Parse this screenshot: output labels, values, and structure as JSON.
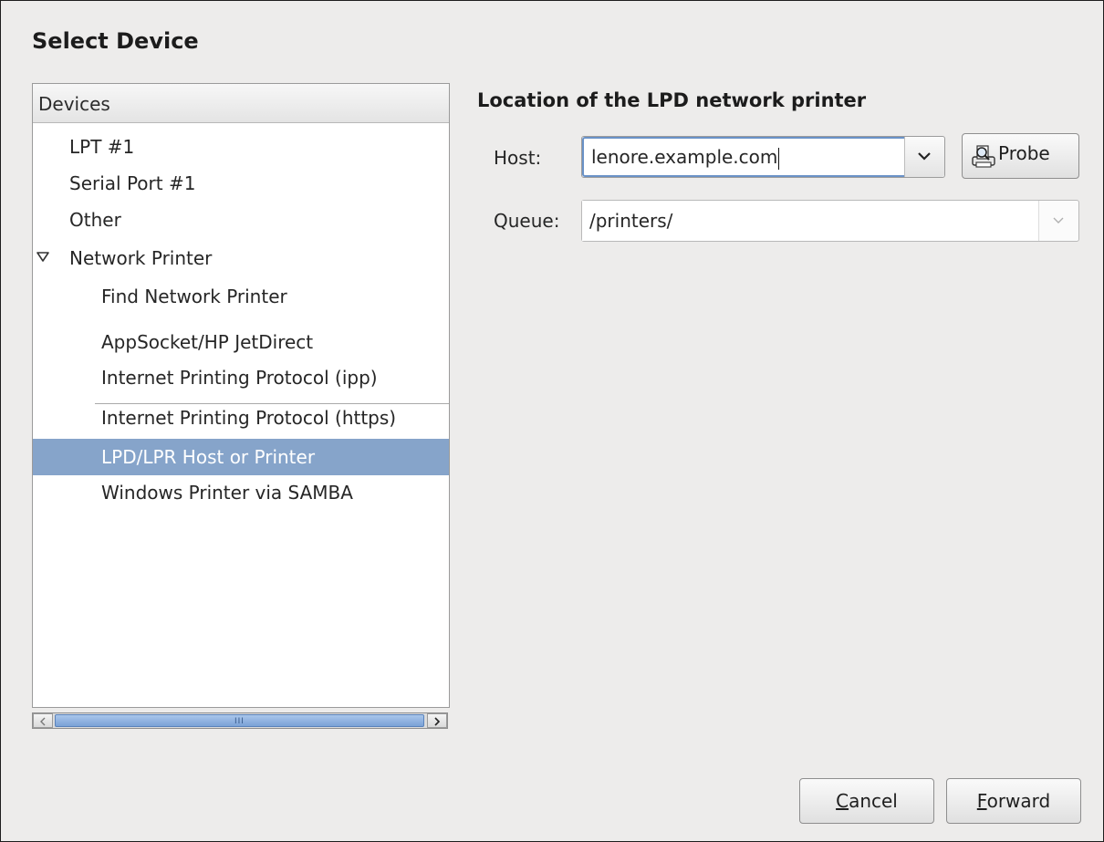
{
  "dialog": {
    "title": "Select Device"
  },
  "devices": {
    "header": "Devices",
    "items": [
      {
        "label": "LPT #1"
      },
      {
        "label": "Serial Port #1"
      },
      {
        "label": "Other"
      },
      {
        "label": "Network Printer",
        "expanded": true
      },
      {
        "label": "Find Network Printer"
      },
      {
        "label": "AppSocket/HP JetDirect"
      },
      {
        "label": "Internet Printing Protocol (ipp)"
      },
      {
        "label": "Internet Printing Protocol (https)"
      },
      {
        "label": "LPD/LPR Host or Printer",
        "selected": true
      },
      {
        "label": "Windows Printer via SAMBA"
      }
    ],
    "scrollbar_grip": "III"
  },
  "lpd": {
    "section_title": "Location of the LPD network printer",
    "host_label": "Host:",
    "host_value": "lenore.example.com",
    "probe_label": "Probe",
    "queue_label": "Queue:",
    "queue_value": "/printers/"
  },
  "buttons": {
    "cancel_mnemonic": "C",
    "cancel_rest": "ancel",
    "forward_mnemonic": "F",
    "forward_rest": "orward"
  },
  "colors": {
    "selection": "#86a4ca",
    "focus_border": "#6a92c7",
    "window_bg": "#edeceb"
  },
  "icons": {
    "expander": "triangle-down-icon",
    "combo_arrow": "chevron-down-icon",
    "probe": "printer-magnifier-icon"
  }
}
